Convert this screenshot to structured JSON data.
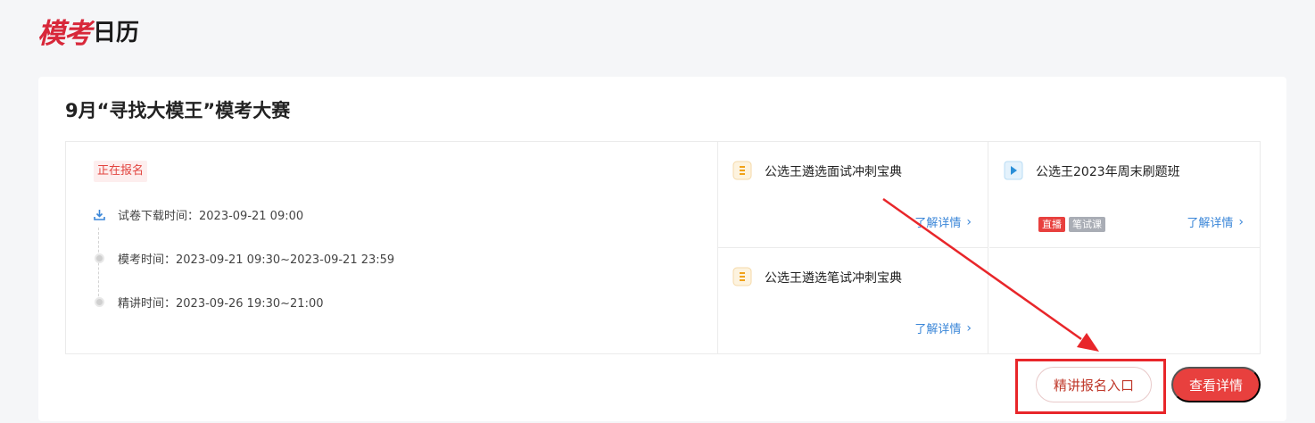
{
  "logo": {
    "red_text": "模考",
    "black_text": "日历"
  },
  "card": {
    "title": "9月“寻找大模王”模考大赛",
    "status": "正在报名",
    "timeline": [
      {
        "icon": "download-icon",
        "text": "试卷下载时间：2023-09-21 09:00"
      },
      {
        "icon": "dot-icon",
        "text": "模考时间：2023-09-21 09:30~2023-09-21 23:59"
      },
      {
        "icon": "dot-icon",
        "text": "精讲时间：2023-09-26 19:30~21:00"
      }
    ],
    "resources": [
      {
        "icon": "document-icon",
        "title": "公选王遴选面试冲刺宝典",
        "more": "了解详情"
      },
      {
        "icon": "play-icon",
        "title": "公选王2023年周末刷题班",
        "more": "了解详情",
        "badges": [
          "直播",
          "笔试课"
        ]
      },
      {
        "icon": "document-icon",
        "title": "公选王遴选笔试冲刺宝典",
        "more": "了解详情"
      }
    ],
    "buttons": {
      "signup": "精讲报名入口",
      "details": "查看详情"
    }
  },
  "colors": {
    "accent": "#e8403e",
    "link": "#3a86d8",
    "annotation": "#e8262a"
  }
}
